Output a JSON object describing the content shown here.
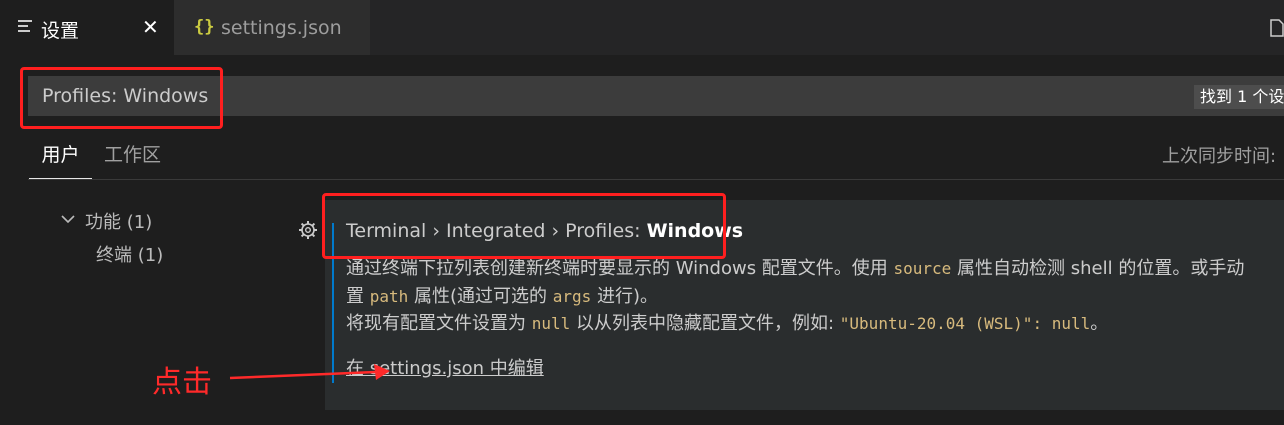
{
  "tabs": [
    {
      "label": "设置",
      "close": "✕",
      "icon": "list-icon"
    },
    {
      "label": "settings.json",
      "icon": "braces-icon",
      "icon_glyph": "{}"
    }
  ],
  "search": {
    "value": "Profiles: Windows",
    "result_badge": "找到 1 个设"
  },
  "scope_tabs": [
    "用户",
    "工作区"
  ],
  "sync_status": "上次同步时间:",
  "toc": [
    {
      "label": "功能 (1)"
    },
    {
      "label": "终端 (1)"
    }
  ],
  "setting": {
    "breadcrumb_prefix": "Terminal › Integrated › ",
    "title_key": "Profiles: ",
    "title_name": "Windows",
    "line1_a": "通过终端下拉列表创建新终端时要显示的 Windows 配置文件。使用 ",
    "line1_code": "source",
    "line1_b": " 属性自动检测 shell 的位置。或手动",
    "line2_a": "置 ",
    "line2_code1": "path",
    "line2_b": " 属性(通过可选的 ",
    "line2_code2": "args",
    "line2_c": " 进行)。",
    "line3_a": "将现有配置文件设置为 ",
    "line3_code1": "null",
    "line3_b": " 以从列表中隐藏配置文件，例如: ",
    "line3_code2": "\"Ubuntu-20.04 (WSL)\": null",
    "line3_c": "。",
    "edit_link": "在 settings.json 中编辑"
  },
  "annotation": {
    "label": "点击",
    "color": "#ff2a2a"
  },
  "colors": {
    "accent": "#007acc",
    "highlight_box": "#ff1f1f",
    "code": "#d7ba7d"
  }
}
